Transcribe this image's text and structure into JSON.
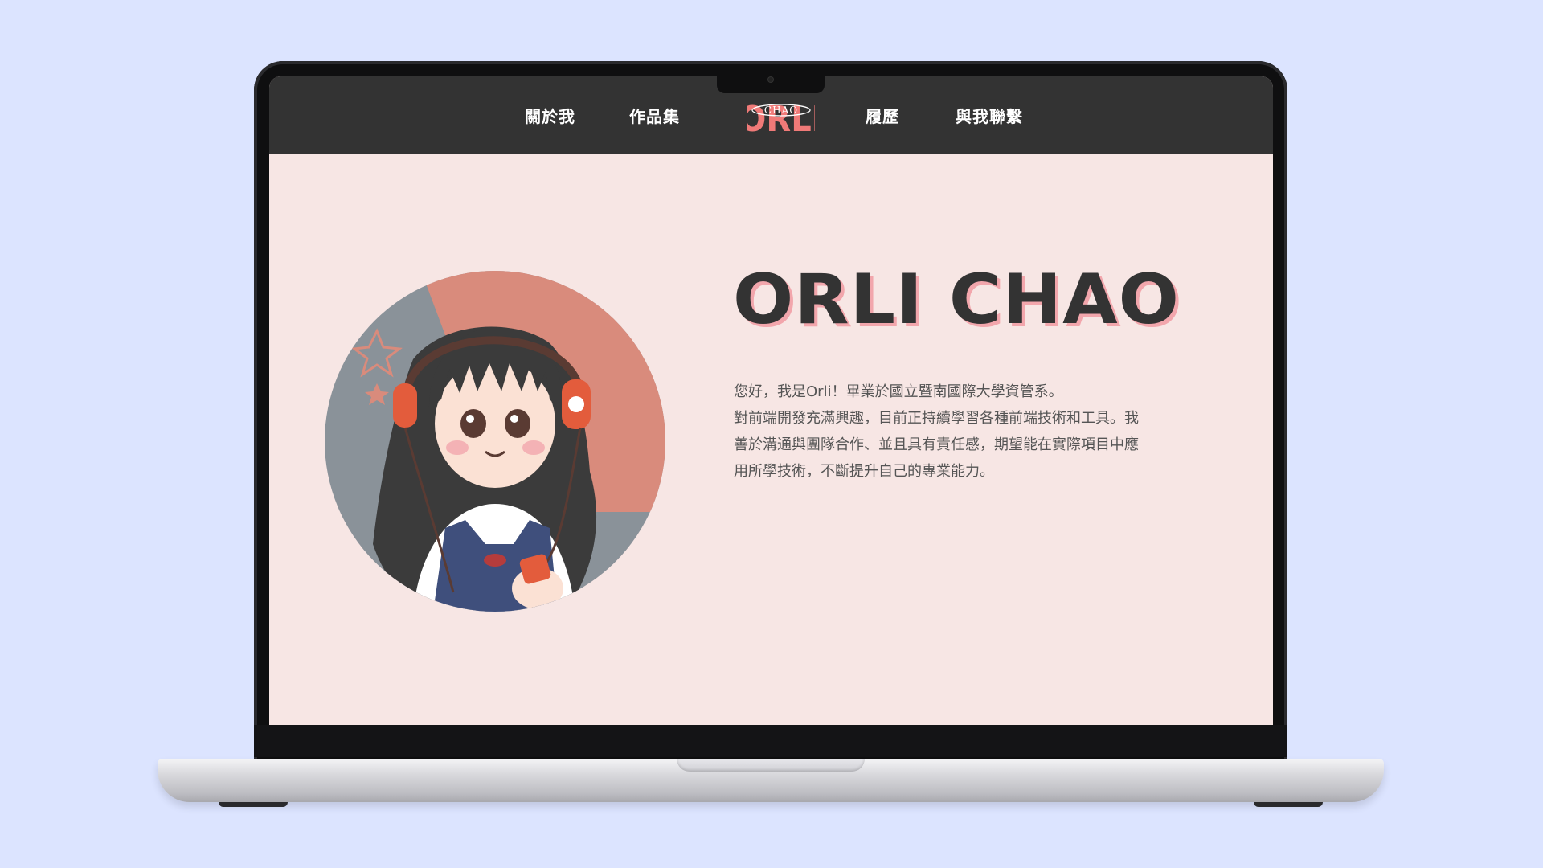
{
  "nav": {
    "items": [
      "關於我",
      "作品集",
      "履歷",
      "與我聯繫"
    ],
    "logo_text": "ORLI",
    "logo_overlay": "CHAO"
  },
  "hero": {
    "name": "ORLI CHAO",
    "intro_lines": [
      "您好，我是Orli！畢業於國立暨南國際大學資管系。",
      "對前端開發充滿興趣，目前正持續學習各種前端技術和工具。我",
      "善於溝通與團隊合作、並且具有責任感，期望能在實際項目中應",
      "用所學技術，不斷提升自己的專業能力。"
    ]
  },
  "colors": {
    "page_bg": "#dce4ff",
    "screen_bg": "#f7e6e4",
    "navbar_bg": "#333333",
    "accent_pink": "#f2a6ac",
    "logo_coral": "#f07a78",
    "text_dark": "#333333"
  }
}
